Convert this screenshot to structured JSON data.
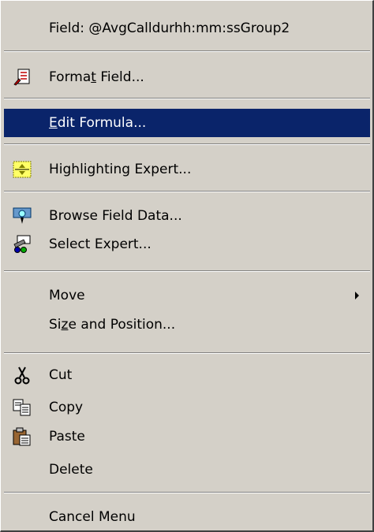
{
  "menu": {
    "header": {
      "label": "Field: @AvgCalldurhh:mm:ssGroup2"
    },
    "items": [
      {
        "pre": "Forma",
        "mn": "t",
        "post": " Field...",
        "icon": "format-field-icon"
      },
      {
        "pre": "",
        "mn": "E",
        "post": "dit Formula...",
        "icon": ""
      },
      {
        "pre": "Highlighting Expert...",
        "mn": "",
        "post": "",
        "icon": "highlighting-expert-icon"
      },
      {
        "pre": "Browse Field Data...",
        "mn": "",
        "post": "",
        "icon": "browse-field-data-icon"
      },
      {
        "pre": "Select Expert...",
        "mn": "",
        "post": "",
        "icon": "select-expert-icon"
      },
      {
        "pre": "Move",
        "mn": "",
        "post": "",
        "icon": "",
        "submenu": "chevron-right-icon"
      },
      {
        "pre": "Si",
        "mn": "z",
        "post": "e and Position...",
        "icon": ""
      },
      {
        "pre": "Cut",
        "mn": "",
        "post": "",
        "icon": "scissors-icon"
      },
      {
        "pre": "Copy",
        "mn": "",
        "post": "",
        "icon": "copy-icon"
      },
      {
        "pre": "Paste",
        "mn": "",
        "post": "",
        "icon": "paste-icon"
      },
      {
        "pre": "Delete",
        "mn": "",
        "post": "",
        "icon": ""
      },
      {
        "pre": "Cancel Menu",
        "mn": "",
        "post": "",
        "icon": ""
      }
    ],
    "selected_item": "Edit Formula...",
    "colors": {
      "highlight": "#0a246a",
      "face": "#d4d0c8"
    }
  }
}
